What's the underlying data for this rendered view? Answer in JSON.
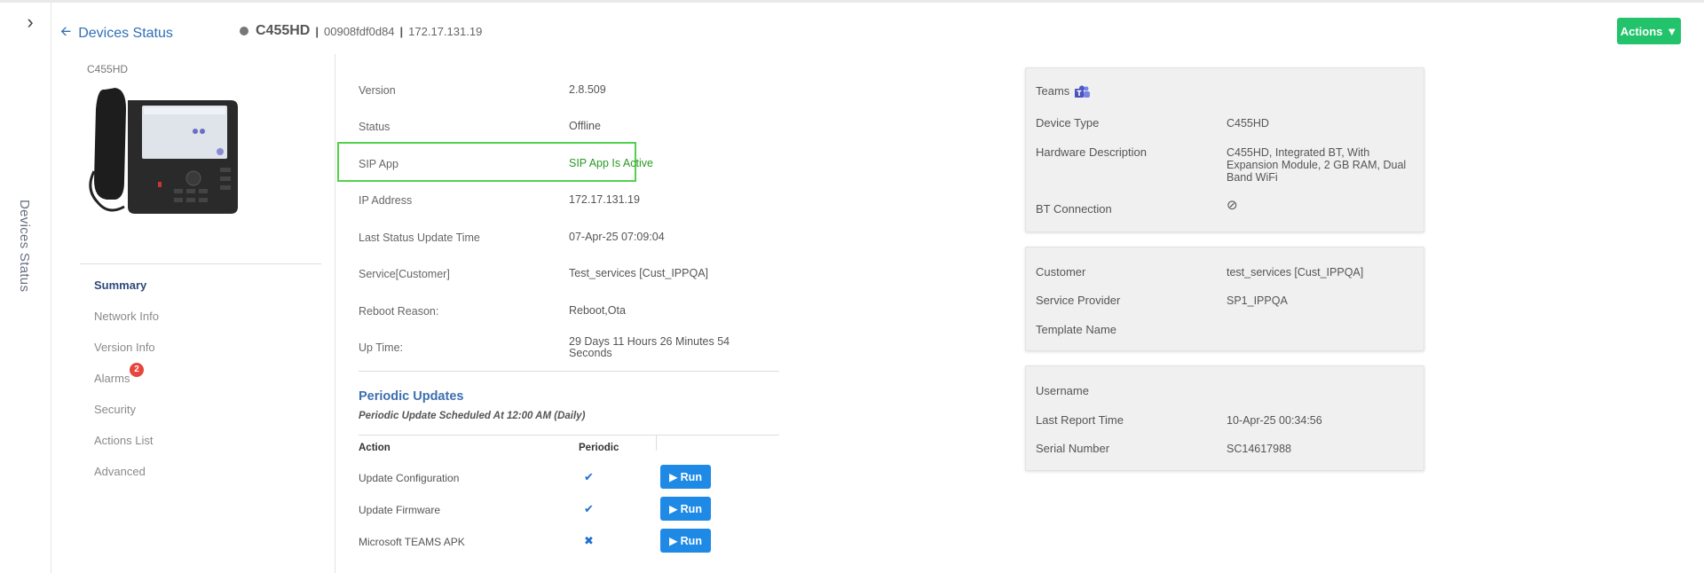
{
  "sidebar": {
    "toggle_icon": "chevron-right-icon",
    "vertical_label": "Devices Status"
  },
  "header": {
    "back_label": "Devices Status",
    "device_model": "C455HD",
    "mac": "00908fdf0d84",
    "ip": "172.17.131.19",
    "separator": "|",
    "actions_label": "Actions",
    "actions_caret": "▼",
    "status_dot_color": "#777777",
    "actions_color": "#22c36b"
  },
  "left": {
    "model_label": "C455HD",
    "nav": [
      {
        "label": "Summary",
        "active": true
      },
      {
        "label": "Network Info"
      },
      {
        "label": "Version Info"
      },
      {
        "label": "Alarms",
        "badge": "2"
      },
      {
        "label": "Security"
      },
      {
        "label": "Actions List"
      },
      {
        "label": "Advanced"
      }
    ]
  },
  "details": {
    "version": {
      "k": "Version",
      "v": "2.8.509"
    },
    "status": {
      "k": "Status",
      "v": "Offline"
    },
    "sip": {
      "k": "SIP App",
      "v": "SIP App Is Active"
    },
    "ip": {
      "k": "IP Address",
      "v": "172.17.131.19"
    },
    "last_status": {
      "k": "Last Status Update Time",
      "v": "07-Apr-25 07:09:04"
    },
    "service": {
      "k": "Service[Customer]",
      "v": "Test_services [Cust_IPPQA]"
    },
    "reboot": {
      "k": "Reboot Reason:",
      "v": "Reboot,Ota"
    },
    "uptime": {
      "k": "Up Time:",
      "v": "29 Days 11 Hours 26 Minutes 54 Seconds"
    }
  },
  "periodic": {
    "title": "Periodic Updates",
    "subtitle": "Periodic Update Scheduled At 12:00 AM (Daily)",
    "col_action": "Action",
    "col_periodic": "Periodic",
    "run_label": "Run",
    "run_icon": "▶",
    "rows": [
      {
        "action": "Update Configuration",
        "periodic": "✔"
      },
      {
        "action": "Update Firmware",
        "periodic": "✔"
      },
      {
        "action": "Microsoft TEAMS APK",
        "periodic": "✖"
      }
    ]
  },
  "card1": {
    "teams_label": "Teams",
    "device_type_k": "Device Type",
    "device_type_v": "C455HD",
    "hw_k": "Hardware Description",
    "hw_v": "C455HD, Integrated BT, With Expansion Module, 2 GB RAM, Dual Band WiFi",
    "bt_k": "BT Connection",
    "bt_v": "⊘"
  },
  "card2": {
    "customer_k": "Customer",
    "customer_v": "test_services [Cust_IPPQA]",
    "sp_k": "Service Provider",
    "sp_v": "SP1_IPPQA",
    "tmpl_k": "Template Name",
    "tmpl_v": ""
  },
  "card3": {
    "user_k": "Username",
    "user_v": "",
    "report_k": "Last Report Time",
    "report_v": "10-Apr-25 00:34:56",
    "serial_k": "Serial Number",
    "serial_v": "SC14617988"
  }
}
